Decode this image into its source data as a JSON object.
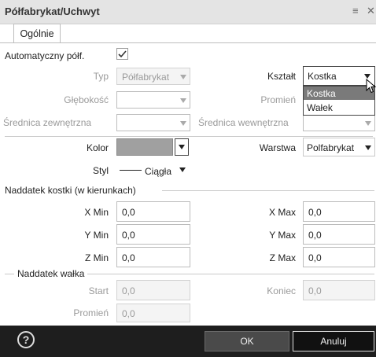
{
  "window": {
    "title": "Półfabrykat/Uchwyt"
  },
  "tabs": [
    {
      "label": "Ogólnie"
    }
  ],
  "auto": {
    "label": "Automatyczny półf.",
    "checked": true
  },
  "typ": {
    "label": "Typ",
    "value": "Półfabrykat"
  },
  "ksztalt": {
    "label": "Kształt",
    "value": "Kostka",
    "options": [
      "Kostka",
      "Wałek"
    ]
  },
  "glebokosc": {
    "label": "Głębokość",
    "value": ""
  },
  "promien_top": {
    "label": "Promień",
    "value": ""
  },
  "sr_zew": {
    "label": "Średnica zewnętrzna",
    "value": ""
  },
  "sr_wew": {
    "label": "Średnica wewnętrzna",
    "value": ""
  },
  "kolor": {
    "label": "Kolor",
    "color": "#a0a0a0"
  },
  "warstwa": {
    "label": "Warstwa",
    "value": "Polfabrykat"
  },
  "styl": {
    "label": "Styl",
    "value": "Ciągła"
  },
  "naddatek_kostki": {
    "title": "Naddatek kostki (w kierunkach)",
    "xmin": {
      "label": "X Min",
      "value": "0,0"
    },
    "xmax": {
      "label": "X Max",
      "value": "0,0"
    },
    "ymin": {
      "label": "Y Min",
      "value": "0,0"
    },
    "ymax": {
      "label": "Y Max",
      "value": "0,0"
    },
    "zmin": {
      "label": "Z Min",
      "value": "0,0"
    },
    "zmax": {
      "label": "Z Max",
      "value": "0,0"
    }
  },
  "naddatek_walka": {
    "title": "Naddatek wałka",
    "start": {
      "label": "Start",
      "value": "0,0"
    },
    "koniec": {
      "label": "Koniec",
      "value": "0,0"
    },
    "promien": {
      "label": "Promień",
      "value": "0,0"
    }
  },
  "footer": {
    "ok_label": "OK",
    "cancel_label": "Anuluj",
    "help_icon": "?"
  }
}
